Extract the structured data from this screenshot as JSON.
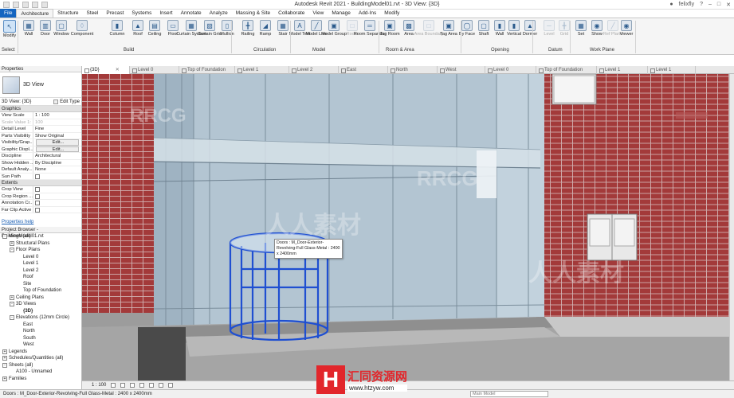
{
  "window": {
    "title": "Autodesk Revit 2021 - BuildingModel01.rvt - 3D View: {3D}",
    "user": "felixfly"
  },
  "ribbon_tabs": [
    "File",
    "Architecture",
    "Structure",
    "Steel",
    "Precast",
    "Systems",
    "Insert",
    "Annotate",
    "Analyze",
    "Massing & Site",
    "Collaborate",
    "View",
    "Manage",
    "Add-Ins",
    "Modify"
  ],
  "ribbon": {
    "buttons": [
      "Modify",
      "Wall",
      "Door",
      "Window",
      "Component",
      "Column",
      "Roof",
      "Ceiling",
      "Floor",
      "Curtain System",
      "Curtain Grid",
      "Mullion",
      "Railing",
      "Ramp",
      "Stair",
      "Model Text",
      "Model Line",
      "Model Group",
      "Room",
      "Room Separator",
      "Tag Room",
      "Area",
      "Area Boundary",
      "Tag Area",
      "By Face",
      "Shaft",
      "Wall",
      "Vertical",
      "Dormer",
      "Level",
      "Grid",
      "Set",
      "Show",
      "Ref Plane",
      "Viewer"
    ],
    "groups": [
      "Select",
      "Build",
      "Circulation",
      "Model",
      "Room & Area",
      "Opening",
      "Datum",
      "Work Plane"
    ]
  },
  "properties": {
    "title": "Properties",
    "type": "3D View",
    "filter": "3D View: {3D}",
    "edit_type": "Edit Type",
    "sections": {
      "graphics": "Graphics",
      "extents": "Extents"
    },
    "rows": [
      {
        "k": "View Scale",
        "v": "1 : 100"
      },
      {
        "k": "Scale Value 1:",
        "v": "100"
      },
      {
        "k": "Detail Level",
        "v": "Fine"
      },
      {
        "k": "Parts Visibility",
        "v": "Show Original"
      },
      {
        "k": "Visibility/Grap...",
        "v": "Edit..."
      },
      {
        "k": "Graphic Displ...",
        "v": "Edit..."
      },
      {
        "k": "Discipline",
        "v": "Architectural"
      },
      {
        "k": "Show Hidden ...",
        "v": "By Discipline"
      },
      {
        "k": "Default Analy...",
        "v": "None"
      },
      {
        "k": "Sun Path",
        "v": ""
      }
    ],
    "extent_rows": [
      {
        "k": "Crop View",
        "v": ""
      },
      {
        "k": "Crop Region ...",
        "v": ""
      },
      {
        "k": "Annotation Cr...",
        "v": ""
      },
      {
        "k": "Far Clip Active",
        "v": ""
      }
    ],
    "help": "Properties help"
  },
  "browser": {
    "title": "Project Browser - BuildingModel01.rvt",
    "nodes": [
      {
        "label": "Views (all)",
        "depth": 0,
        "toggle": "-"
      },
      {
        "label": "Structural Plans",
        "depth": 1,
        "toggle": "+"
      },
      {
        "label": "Floor Plans",
        "depth": 1,
        "toggle": "-"
      },
      {
        "label": "Level 0",
        "depth": 2
      },
      {
        "label": "Level 1",
        "depth": 2
      },
      {
        "label": "Level 2",
        "depth": 2
      },
      {
        "label": "Roof",
        "depth": 2
      },
      {
        "label": "Site",
        "depth": 2
      },
      {
        "label": "Top of Foundation",
        "depth": 2
      },
      {
        "label": "Ceiling Plans",
        "depth": 1,
        "toggle": "+"
      },
      {
        "label": "3D Views",
        "depth": 1,
        "toggle": "-"
      },
      {
        "label": "{3D}",
        "depth": 2,
        "bold": true
      },
      {
        "label": "Elevations (12mm Circle)",
        "depth": 1,
        "toggle": "-"
      },
      {
        "label": "East",
        "depth": 2
      },
      {
        "label": "North",
        "depth": 2
      },
      {
        "label": "South",
        "depth": 2
      },
      {
        "label": "West",
        "depth": 2
      },
      {
        "label": "Legends",
        "depth": 0,
        "toggle": "+"
      },
      {
        "label": "Schedules/Quantities (all)",
        "depth": 0,
        "toggle": "+"
      },
      {
        "label": "Sheets (all)",
        "depth": 0,
        "toggle": "-"
      },
      {
        "label": "A100 - Unnamed",
        "depth": 1
      },
      {
        "label": "Families",
        "depth": 0,
        "toggle": "+"
      }
    ]
  },
  "view_tabs": [
    "{3D}",
    "Level 0",
    "Top of Foundation",
    "Level 1",
    "Level 2",
    "East",
    "North",
    "West",
    "Level 0",
    "Top of Foundation",
    "Level 1",
    "Level 1"
  ],
  "tooltip": "Doors : M_Door-Exterior-Revolving-Full Glass-Metal : 2400 x 2400mm",
  "status": {
    "scale": "1 : 100",
    "message": "Doors : M_Door-Exterior-Revolving-Full Glass-Metal : 2400 x 2400mm",
    "workset": "Main Model"
  },
  "watermark": {
    "rrcg": "RRCG",
    "cn": "人人素材",
    "logo_h": "H",
    "logo_cn": "汇同资源网",
    "logo_url": "www.htzyw.com"
  },
  "colors": {
    "brick": "#a03838",
    "glass": "#a9bbc9",
    "door_highlight": "#1f4fd1",
    "accent": "#1565c0"
  }
}
